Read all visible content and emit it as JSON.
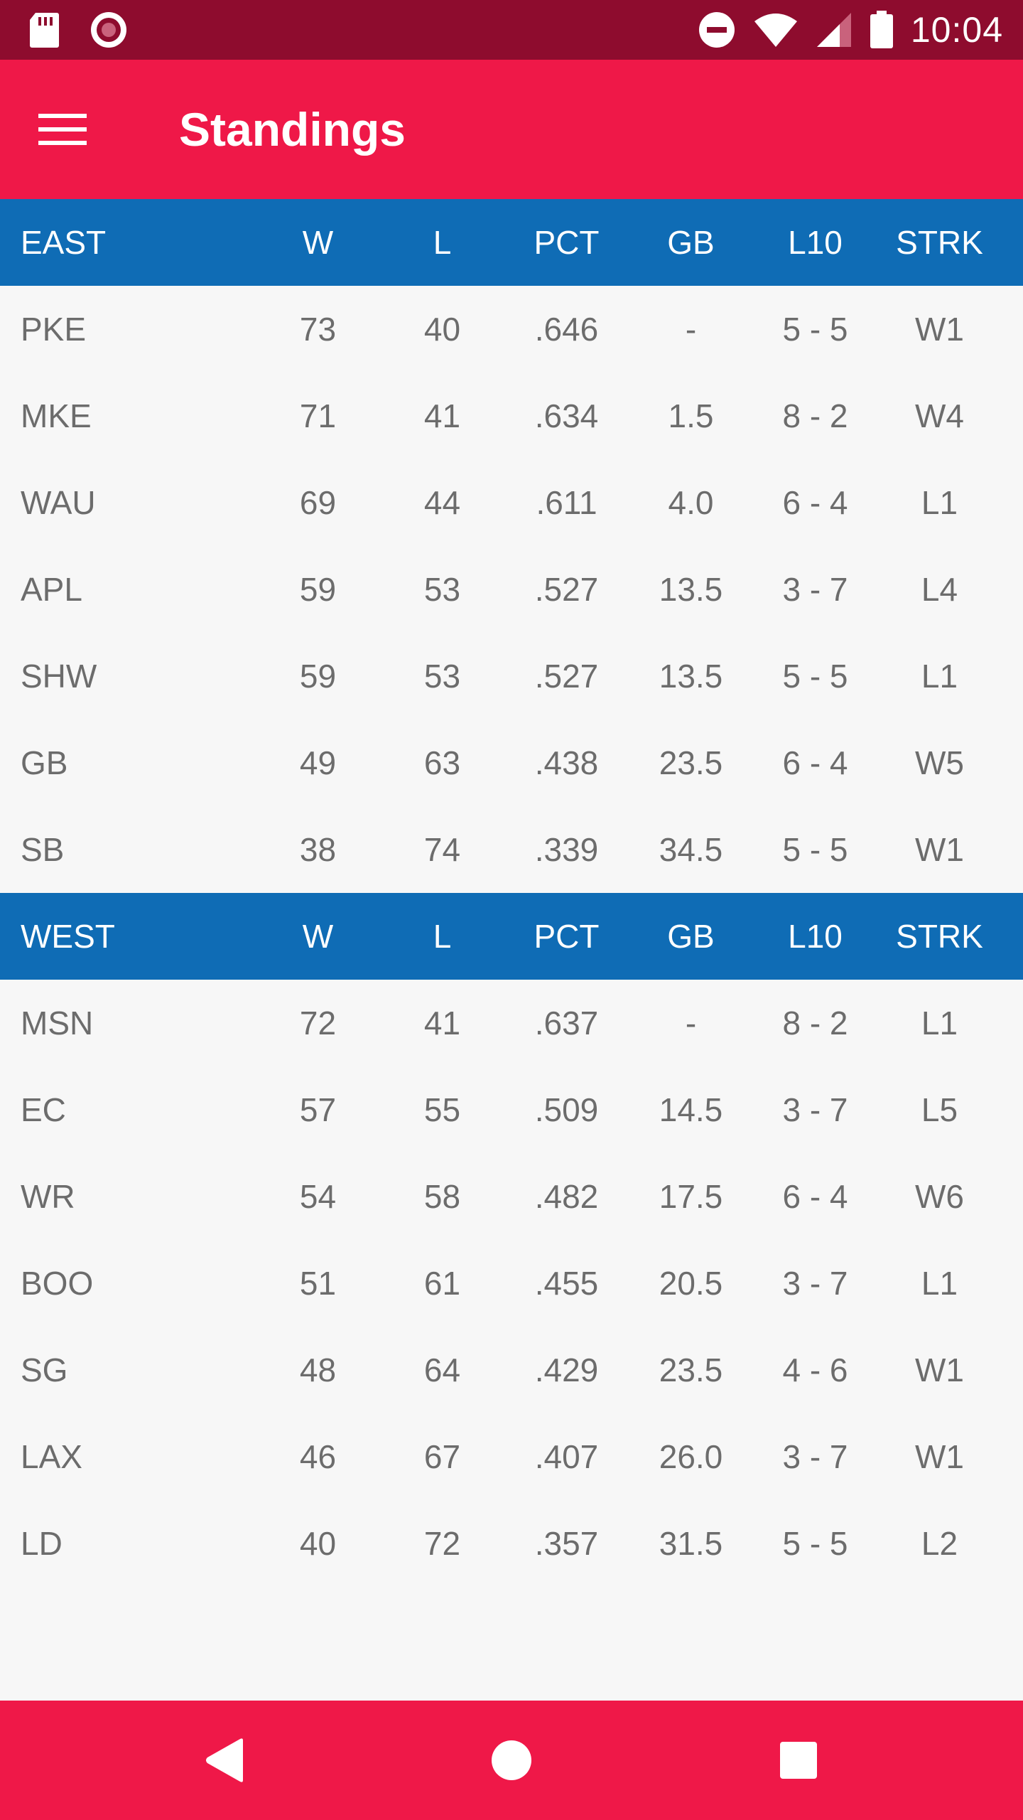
{
  "status_bar": {
    "time": "10:04",
    "icons_left": [
      "sd-card-icon",
      "record-icon"
    ],
    "icons_right": [
      "do-not-disturb-icon",
      "wifi-icon",
      "signal-icon",
      "battery-icon"
    ]
  },
  "app_bar": {
    "title": "Standings",
    "menu_icon": "hamburger-menu-icon"
  },
  "columns": [
    "W",
    "L",
    "PCT",
    "GB",
    "L10",
    "STRK"
  ],
  "divisions": [
    {
      "name": "EAST",
      "rows": [
        {
          "team": "PKE",
          "w": "73",
          "l": "40",
          "pct": ".646",
          "gb": "-",
          "l10": "5 - 5",
          "strk": "W1"
        },
        {
          "team": "MKE",
          "w": "71",
          "l": "41",
          "pct": ".634",
          "gb": "1.5",
          "l10": "8 - 2",
          "strk": "W4"
        },
        {
          "team": "WAU",
          "w": "69",
          "l": "44",
          "pct": ".611",
          "gb": "4.0",
          "l10": "6 - 4",
          "strk": "L1"
        },
        {
          "team": "APL",
          "w": "59",
          "l": "53",
          "pct": ".527",
          "gb": "13.5",
          "l10": "3 - 7",
          "strk": "L4"
        },
        {
          "team": "SHW",
          "w": "59",
          "l": "53",
          "pct": ".527",
          "gb": "13.5",
          "l10": "5 - 5",
          "strk": "L1"
        },
        {
          "team": "GB",
          "w": "49",
          "l": "63",
          "pct": ".438",
          "gb": "23.5",
          "l10": "6 - 4",
          "strk": "W5"
        },
        {
          "team": "SB",
          "w": "38",
          "l": "74",
          "pct": ".339",
          "gb": "34.5",
          "l10": "5 - 5",
          "strk": "W1"
        }
      ]
    },
    {
      "name": "WEST",
      "rows": [
        {
          "team": "MSN",
          "w": "72",
          "l": "41",
          "pct": ".637",
          "gb": "-",
          "l10": "8 - 2",
          "strk": "L1"
        },
        {
          "team": "EC",
          "w": "57",
          "l": "55",
          "pct": ".509",
          "gb": "14.5",
          "l10": "3 - 7",
          "strk": "L5"
        },
        {
          "team": "WR",
          "w": "54",
          "l": "58",
          "pct": ".482",
          "gb": "17.5",
          "l10": "6 - 4",
          "strk": "W6"
        },
        {
          "team": "BOO",
          "w": "51",
          "l": "61",
          "pct": ".455",
          "gb": "20.5",
          "l10": "3 - 7",
          "strk": "L1"
        },
        {
          "team": "SG",
          "w": "48",
          "l": "64",
          "pct": ".429",
          "gb": "23.5",
          "l10": "4 - 6",
          "strk": "W1"
        },
        {
          "team": "LAX",
          "w": "46",
          "l": "67",
          "pct": ".407",
          "gb": "26.0",
          "l10": "3 - 7",
          "strk": "W1"
        },
        {
          "team": "LD",
          "w": "40",
          "l": "72",
          "pct": ".357",
          "gb": "31.5",
          "l10": "5 - 5",
          "strk": "L2"
        }
      ]
    }
  ],
  "nav_bar": {
    "buttons": [
      "back-icon",
      "home-icon",
      "recents-icon"
    ]
  },
  "colors": {
    "status_bar": "#8e0c2e",
    "app_bar": "#ef1848",
    "section_header": "#0f6cb5",
    "row_text": "#6c6c6c",
    "background": "#f7f7f7"
  }
}
